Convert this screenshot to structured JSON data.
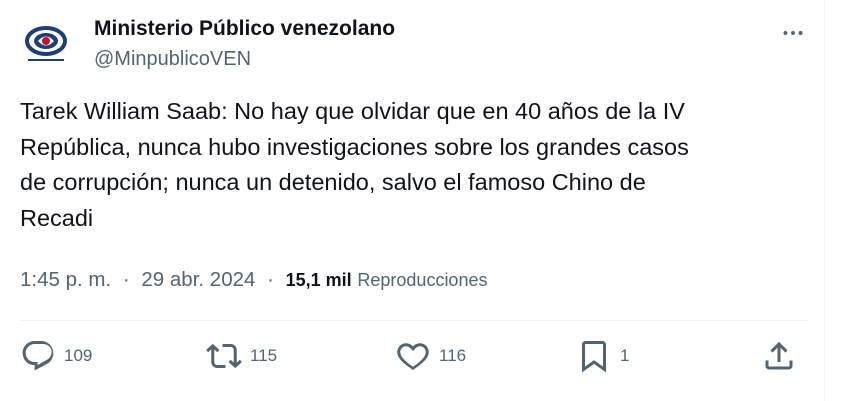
{
  "colors": {
    "text_primary": "#0f1419",
    "text_secondary": "#536471",
    "divider": "#eff3f4",
    "logo_blue": "#1c3f74"
  },
  "author": {
    "display_name": "Ministerio Público venezolano",
    "handle": "@MinpublicoVEN",
    "avatar_icon": "ministerio-publico-logo"
  },
  "tweet": {
    "text": "Tarek William Saab: No hay que olvidar que en 40 años de la IV\nRepública, nunca hubo investigaciones sobre los grandes casos\nde corrupción; nunca un detenido, salvo el famoso Chino de\nRecadi"
  },
  "meta": {
    "time": "1:45 p. m.",
    "date": "29 abr. 2024",
    "separator": "·",
    "views_count": "15,1 mil",
    "views_label": "Reproducciones"
  },
  "actions": {
    "reply": {
      "icon": "reply-icon",
      "count": "109"
    },
    "retweet": {
      "icon": "retweet-icon",
      "count": "115"
    },
    "like": {
      "icon": "heart-icon",
      "count": "116"
    },
    "bookmark": {
      "icon": "bookmark-icon",
      "count": "1"
    },
    "share": {
      "icon": "share-icon"
    }
  },
  "more_icon": "more-icon"
}
